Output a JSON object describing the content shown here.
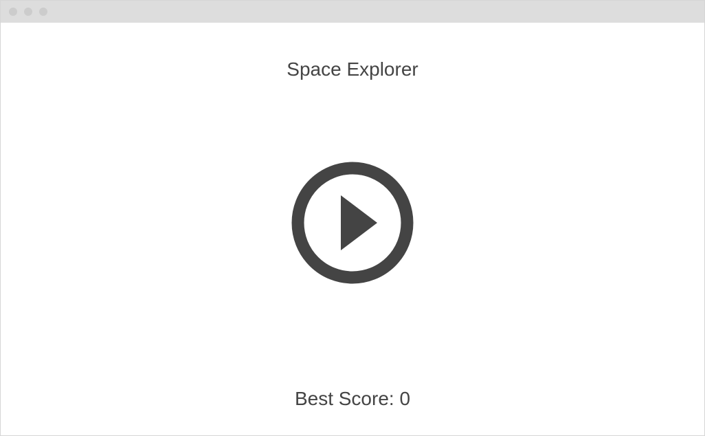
{
  "window": {
    "controls": [
      "close",
      "minimize",
      "zoom"
    ],
    "control_color": "#cccccc",
    "titlebar_color": "#dddddd"
  },
  "game": {
    "title": "Space Explorer",
    "play_icon": "play-circle-icon",
    "best_score_label": "Best Score: 0",
    "accent_color": "#444444"
  }
}
